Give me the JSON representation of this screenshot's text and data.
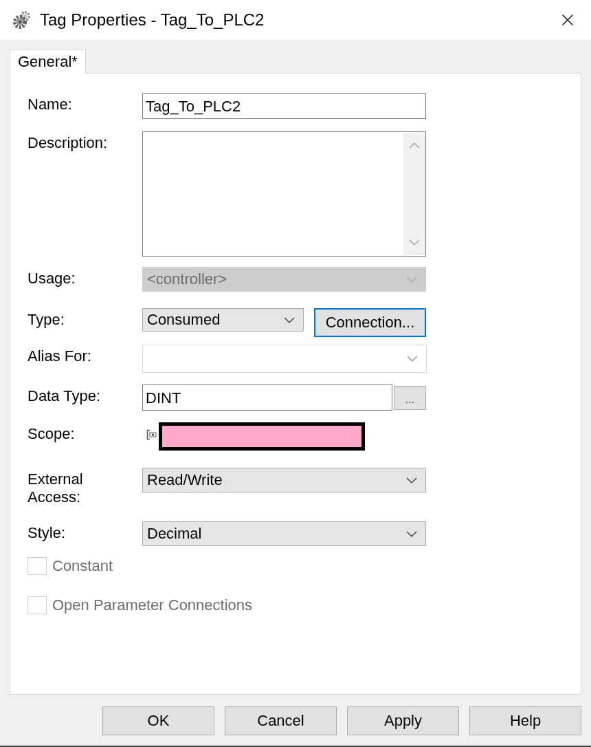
{
  "window": {
    "title": "Tag Properties - Tag_To_PLC2"
  },
  "tabs": [
    {
      "label": "General*",
      "selected": true
    }
  ],
  "fields": [
    {
      "kind": "text",
      "label": "Name:",
      "value": "Tag_To_PLC2"
    },
    {
      "kind": "memo",
      "label": "Description:"
    },
    {
      "kind": "dropdown",
      "label": "Usage:",
      "value": "<controller>",
      "disabled": true
    },
    {
      "kind": "dropdown",
      "label": "Type:",
      "value": "Consumed",
      "disabled": false,
      "button": {
        "label": "Connection...",
        "focused": true
      }
    },
    {
      "kind": "combo",
      "label": "Alias For:",
      "disabled": true
    },
    {
      "kind": "browse",
      "label": "Data Type:",
      "value": "DINT",
      "button": {
        "label": "...",
        "focused": false
      }
    },
    {
      "kind": "scope",
      "label": "Scope:"
    },
    {
      "kind": "dropdown",
      "label": "External Access:",
      "value": "Read/Write",
      "disabled": false
    },
    {
      "kind": "dropdown",
      "label": "Style:",
      "value": "Decimal",
      "disabled": false
    }
  ],
  "checkboxes": [
    {
      "label": "Constant",
      "checked": false,
      "disabled": true
    },
    {
      "label": "Open Parameter Connections",
      "checked": false,
      "disabled": true
    }
  ],
  "buttons": [
    {
      "label": "OK"
    },
    {
      "label": "Cancel"
    },
    {
      "label": "Apply"
    },
    {
      "label": "Help"
    }
  ]
}
